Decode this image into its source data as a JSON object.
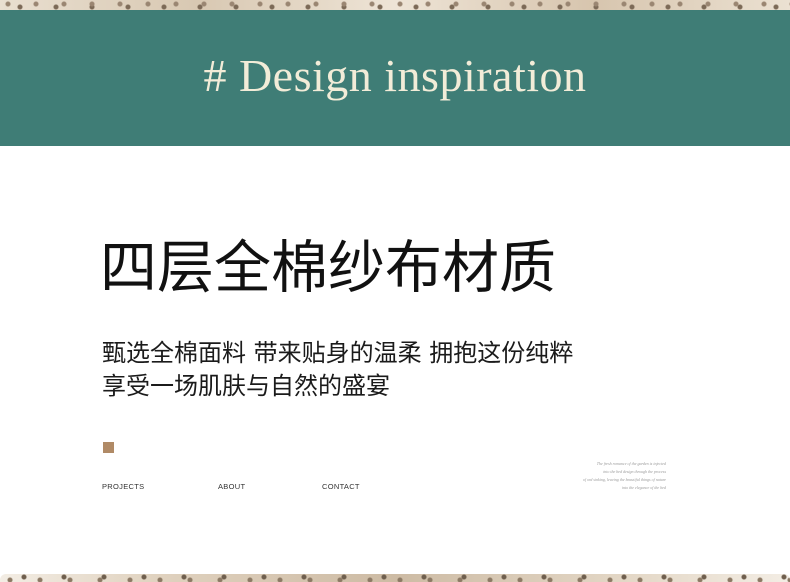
{
  "header": {
    "title": "# Design inspiration"
  },
  "headline": "四层全棉纱布材质",
  "subtext": {
    "line1": "甄选全棉面料 带来贴身的温柔 拥抱这份纯粹",
    "line2": "享受一场肌肤与自然的盛宴"
  },
  "nav": {
    "projects": "PROJECTS",
    "about": "ABOUT",
    "contact": "CONTACT"
  },
  "quote": {
    "line1": "The fresh romance of the garden is injected",
    "line2": "into the bed design through the process",
    "line3": "of ord sinking, leaving the beautiful things of nature",
    "line4": "into the elegance of the bed"
  },
  "colors": {
    "header_bg": "#3f7d76",
    "header_text": "#f2ecd8",
    "accent_square": "#b08a66"
  }
}
